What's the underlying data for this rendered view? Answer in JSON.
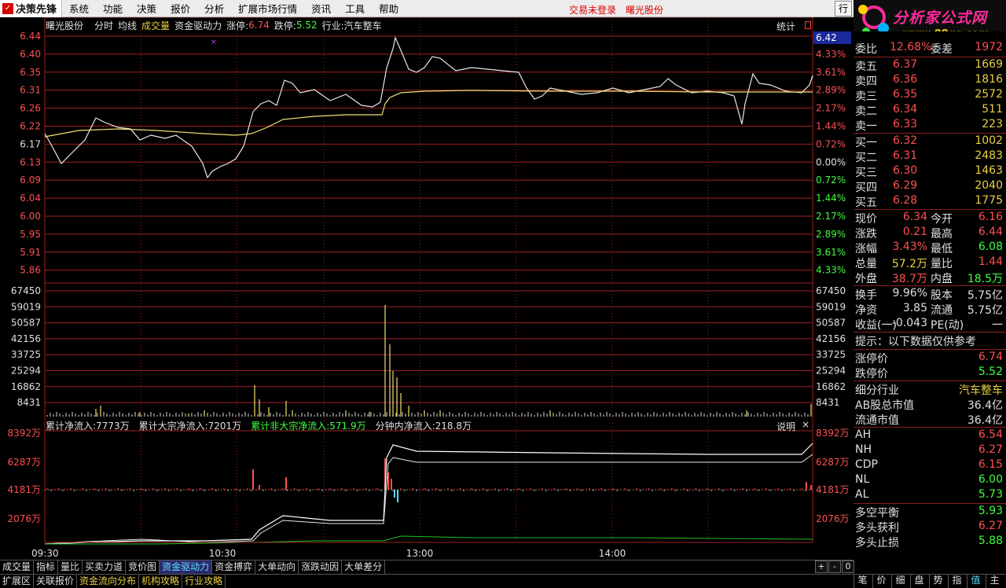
{
  "app": {
    "name": "决策先锋"
  },
  "menu": [
    "系统",
    "功能",
    "决策",
    "报价",
    "分析",
    "扩展市场行情",
    "资讯",
    "工具",
    "帮助"
  ],
  "status": {
    "trade": "交易未登录",
    "stock": "曙光股份"
  },
  "menu_right_label": "行",
  "banner": {
    "title": "分析家公式网",
    "url": "www.88gs.com"
  },
  "info_bar": {
    "stock": "曙光股份",
    "fenshi": "分时",
    "junxian": "均线",
    "volume": "成交量",
    "fund": "资金驱动力",
    "zhangting_label": "涨停:",
    "zhangting": "6.74",
    "dieting_label": "跌停:",
    "dieting": "5.52",
    "industry_label": "行业:",
    "industry": "汽车整车",
    "stats": "统计"
  },
  "price_axis": {
    "left": [
      "6.44",
      "6.40",
      "6.35",
      "6.31",
      "6.26",
      "6.22",
      "6.17",
      "6.13",
      "6.09",
      "6.04",
      "6.00",
      "5.95",
      "5.91",
      "5.86"
    ],
    "right": [
      "4.33%",
      "3.61%",
      "2.89%",
      "2.17%",
      "1.44%",
      "0.72%",
      "0.00%",
      "0.72%",
      "1.44%",
      "2.17%",
      "2.89%",
      "3.61%",
      "4.33%"
    ],
    "current_tag": "6.42"
  },
  "volume_axis": {
    "labels": [
      "67450",
      "59019",
      "50587",
      "42156",
      "33725",
      "25294",
      "16862",
      "8431"
    ]
  },
  "fund_info": {
    "total": "累计净流入:7773万",
    "large": "累计大宗净流入:7201万",
    "nonlarge": "累计非大宗净流入:571.9万",
    "minute": "分钟内净流入:218.8万",
    "explain": "说明"
  },
  "fund_axis": {
    "labels": [
      "8392万",
      "6287万",
      "4181万",
      "2076万"
    ]
  },
  "time_axis": [
    "09:30",
    "10:30",
    "13:00",
    "14:00"
  ],
  "quote": {
    "partial_top": {
      "l1": "委比",
      "v1": "12.68%",
      "l2": "委差",
      "v2": "1972"
    },
    "sell": [
      {
        "label": "卖五",
        "price": "6.37",
        "vol": "1669"
      },
      {
        "label": "卖四",
        "price": "6.36",
        "vol": "1816"
      },
      {
        "label": "卖三",
        "price": "6.35",
        "vol": "2572"
      },
      {
        "label": "卖二",
        "price": "6.34",
        "vol": "511"
      },
      {
        "label": "卖一",
        "price": "6.33",
        "vol": "223"
      }
    ],
    "buy": [
      {
        "label": "买一",
        "price": "6.32",
        "vol": "1002"
      },
      {
        "label": "买二",
        "price": "6.31",
        "vol": "2483"
      },
      {
        "label": "买三",
        "price": "6.30",
        "vol": "1463"
      },
      {
        "label": "买四",
        "price": "6.29",
        "vol": "2040"
      },
      {
        "label": "买五",
        "price": "6.28",
        "vol": "1775"
      }
    ],
    "stats": [
      {
        "l1": "现价",
        "v1": "6.34",
        "c1": "#ff5050",
        "l2": "今开",
        "v2": "6.16",
        "c2": "#ff5050"
      },
      {
        "l1": "涨跌",
        "v1": "0.21",
        "c1": "#ff5050",
        "l2": "最高",
        "v2": "6.44",
        "c2": "#ff5050"
      },
      {
        "l1": "涨幅",
        "v1": "3.43%",
        "c1": "#ff5050",
        "l2": "最低",
        "v2": "6.08",
        "c2": "#40ff40"
      },
      {
        "l1": "总量",
        "v1": "57.2万",
        "c1": "#e8d040",
        "l2": "量比",
        "v2": "1.44",
        "c2": "#ff5050"
      },
      {
        "l1": "外盘",
        "v1": "38.7万",
        "c1": "#ff5050",
        "l2": "内盘",
        "v2": "18.5万",
        "c2": "#40ff40"
      }
    ],
    "stats2": [
      {
        "l1": "换手",
        "v1": "9.96%",
        "c1": "#e0e0e0",
        "l2": "股本",
        "v2": "5.75亿",
        "c2": "#e0e0e0"
      },
      {
        "l1": "净资",
        "v1": "3.85",
        "c1": "#e0e0e0",
        "l2": "流通",
        "v2": "5.75亿",
        "c2": "#e0e0e0"
      },
      {
        "l1": "收益(一)",
        "v1": "-0.043",
        "c1": "#e0e0e0",
        "l2": "PE(动)",
        "v2": "一",
        "c2": "#e0e0e0"
      }
    ],
    "hint": "提示：以下数据仅供参考",
    "limits": [
      {
        "label": "涨停价",
        "value": "6.74",
        "color": "#ff5050"
      },
      {
        "label": "跌停价",
        "value": "5.52",
        "color": "#40ff40"
      }
    ],
    "industry": {
      "label": "细分行业",
      "value": "汽车整车"
    },
    "market_cap": [
      {
        "label": "AB股总市值",
        "value": "36.4亿"
      },
      {
        "label": "流通市值",
        "value": "36.4亿"
      }
    ],
    "indicators": [
      {
        "label": "AH",
        "value": "6.54",
        "color": "#ff5050"
      },
      {
        "label": "NH",
        "value": "6.27",
        "color": "#ff5050"
      },
      {
        "label": "CDP",
        "value": "6.15",
        "color": "#ff5050"
      },
      {
        "label": "NL",
        "value": "6.00",
        "color": "#40ff40"
      },
      {
        "label": "AL",
        "value": "5.73",
        "color": "#40ff40"
      }
    ],
    "balance": [
      {
        "label": "多空平衡",
        "value": "5.93",
        "color": "#40ff40"
      },
      {
        "label": "多头获利",
        "value": "6.27",
        "color": "#ff5050"
      },
      {
        "label": "多头止损",
        "value": "5.88",
        "color": "#40ff40"
      }
    ]
  },
  "bottom_tabs1": [
    "成交量",
    "指标",
    "量比",
    "买卖力道",
    "竞价图",
    "资金驱动力",
    "资金搏弈",
    "大单动向",
    "涨跌动因",
    "大单差分"
  ],
  "bottom_tabs2": [
    "扩展区",
    "关联报价",
    "资金流向分布",
    "机构攻略",
    "行业攻略"
  ],
  "zoom_buttons": [
    "+",
    "-",
    "0"
  ],
  "right_tabs": [
    "笔",
    "价",
    "细",
    "盘",
    "势",
    "指",
    "值",
    "主"
  ]
}
